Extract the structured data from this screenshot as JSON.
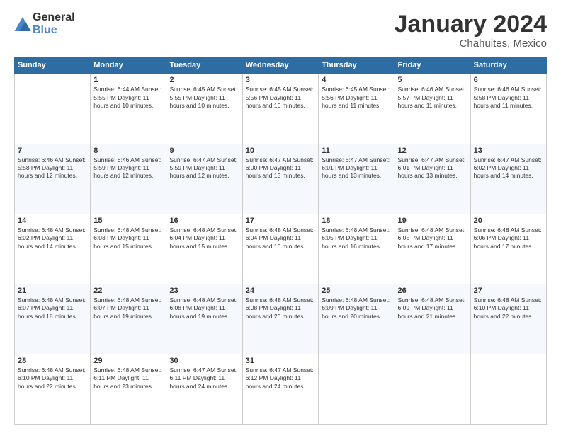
{
  "header": {
    "logo_general": "General",
    "logo_blue": "Blue",
    "title": "January 2024",
    "location": "Chahuites, Mexico"
  },
  "days_of_week": [
    "Sunday",
    "Monday",
    "Tuesday",
    "Wednesday",
    "Thursday",
    "Friday",
    "Saturday"
  ],
  "weeks": [
    [
      {
        "day": "",
        "info": ""
      },
      {
        "day": "1",
        "info": "Sunrise: 6:44 AM\nSunset: 5:55 PM\nDaylight: 11 hours\nand 10 minutes."
      },
      {
        "day": "2",
        "info": "Sunrise: 6:45 AM\nSunset: 5:55 PM\nDaylight: 11 hours\nand 10 minutes."
      },
      {
        "day": "3",
        "info": "Sunrise: 6:45 AM\nSunset: 5:56 PM\nDaylight: 11 hours\nand 10 minutes."
      },
      {
        "day": "4",
        "info": "Sunrise: 6:45 AM\nSunset: 5:56 PM\nDaylight: 11 hours\nand 11 minutes."
      },
      {
        "day": "5",
        "info": "Sunrise: 6:46 AM\nSunset: 5:57 PM\nDaylight: 11 hours\nand 11 minutes."
      },
      {
        "day": "6",
        "info": "Sunrise: 6:46 AM\nSunset: 5:58 PM\nDaylight: 11 hours\nand 11 minutes."
      }
    ],
    [
      {
        "day": "7",
        "info": "Daylight: 11 hours\nand 12 minutes."
      },
      {
        "day": "8",
        "info": "Sunrise: 6:46 AM\nSunset: 5:59 PM\nDaylight: 11 hours\nand 12 minutes."
      },
      {
        "day": "9",
        "info": "Sunrise: 6:47 AM\nSunset: 5:59 PM\nDaylight: 11 hours\nand 12 minutes."
      },
      {
        "day": "10",
        "info": "Sunrise: 6:47 AM\nSunset: 6:00 PM\nDaylight: 11 hours\nand 13 minutes."
      },
      {
        "day": "11",
        "info": "Sunrise: 6:47 AM\nSunset: 6:01 PM\nDaylight: 11 hours\nand 13 minutes."
      },
      {
        "day": "12",
        "info": "Sunrise: 6:47 AM\nSunset: 6:01 PM\nDaylight: 11 hours\nand 13 minutes."
      },
      {
        "day": "13",
        "info": "Sunrise: 6:47 AM\nSunset: 6:02 PM\nDaylight: 11 hours\nand 14 minutes."
      }
    ],
    [
      {
        "day": "14",
        "info": "Sunrise: 6:48 AM\nSunset: 6:02 PM\nDaylight: 11 hours\nand 14 minutes."
      },
      {
        "day": "15",
        "info": "Sunrise: 6:48 AM\nSunset: 6:03 PM\nDaylight: 11 hours\nand 15 minutes."
      },
      {
        "day": "16",
        "info": "Sunrise: 6:48 AM\nSunset: 6:04 PM\nDaylight: 11 hours\nand 15 minutes."
      },
      {
        "day": "17",
        "info": "Sunrise: 6:48 AM\nSunset: 6:04 PM\nDaylight: 11 hours\nand 16 minutes."
      },
      {
        "day": "18",
        "info": "Sunrise: 6:48 AM\nSunset: 6:05 PM\nDaylight: 11 hours\nand 16 minutes."
      },
      {
        "day": "19",
        "info": "Sunrise: 6:48 AM\nSunset: 6:05 PM\nDaylight: 11 hours\nand 17 minutes."
      },
      {
        "day": "20",
        "info": "Sunrise: 6:48 AM\nSunset: 6:06 PM\nDaylight: 11 hours\nand 17 minutes."
      }
    ],
    [
      {
        "day": "21",
        "info": "Sunrise: 6:48 AM\nSunset: 6:07 PM\nDaylight: 11 hours\nand 18 minutes."
      },
      {
        "day": "22",
        "info": "Sunrise: 6:48 AM\nSunset: 6:07 PM\nDaylight: 11 hours\nand 19 minutes."
      },
      {
        "day": "23",
        "info": "Sunrise: 6:48 AM\nSunset: 6:08 PM\nDaylight: 11 hours\nand 19 minutes."
      },
      {
        "day": "24",
        "info": "Sunrise: 6:48 AM\nSunset: 6:08 PM\nDaylight: 11 hours\nand 20 minutes."
      },
      {
        "day": "25",
        "info": "Sunrise: 6:48 AM\nSunset: 6:09 PM\nDaylight: 11 hours\nand 20 minutes."
      },
      {
        "day": "26",
        "info": "Sunrise: 6:48 AM\nSunset: 6:09 PM\nDaylight: 11 hours\nand 21 minutes."
      },
      {
        "day": "27",
        "info": "Sunrise: 6:48 AM\nSunset: 6:10 PM\nDaylight: 11 hours\nand 22 minutes."
      }
    ],
    [
      {
        "day": "28",
        "info": "Sunrise: 6:48 AM\nSunset: 6:10 PM\nDaylight: 11 hours\nand 22 minutes."
      },
      {
        "day": "29",
        "info": "Sunrise: 6:48 AM\nSunset: 6:11 PM\nDaylight: 11 hours\nand 23 minutes."
      },
      {
        "day": "30",
        "info": "Sunrise: 6:47 AM\nSunset: 6:11 PM\nDaylight: 11 hours\nand 24 minutes."
      },
      {
        "day": "31",
        "info": "Sunrise: 6:47 AM\nSunset: 6:12 PM\nDaylight: 11 hours\nand 24 minutes."
      },
      {
        "day": "",
        "info": ""
      },
      {
        "day": "",
        "info": ""
      },
      {
        "day": "",
        "info": ""
      }
    ]
  ]
}
